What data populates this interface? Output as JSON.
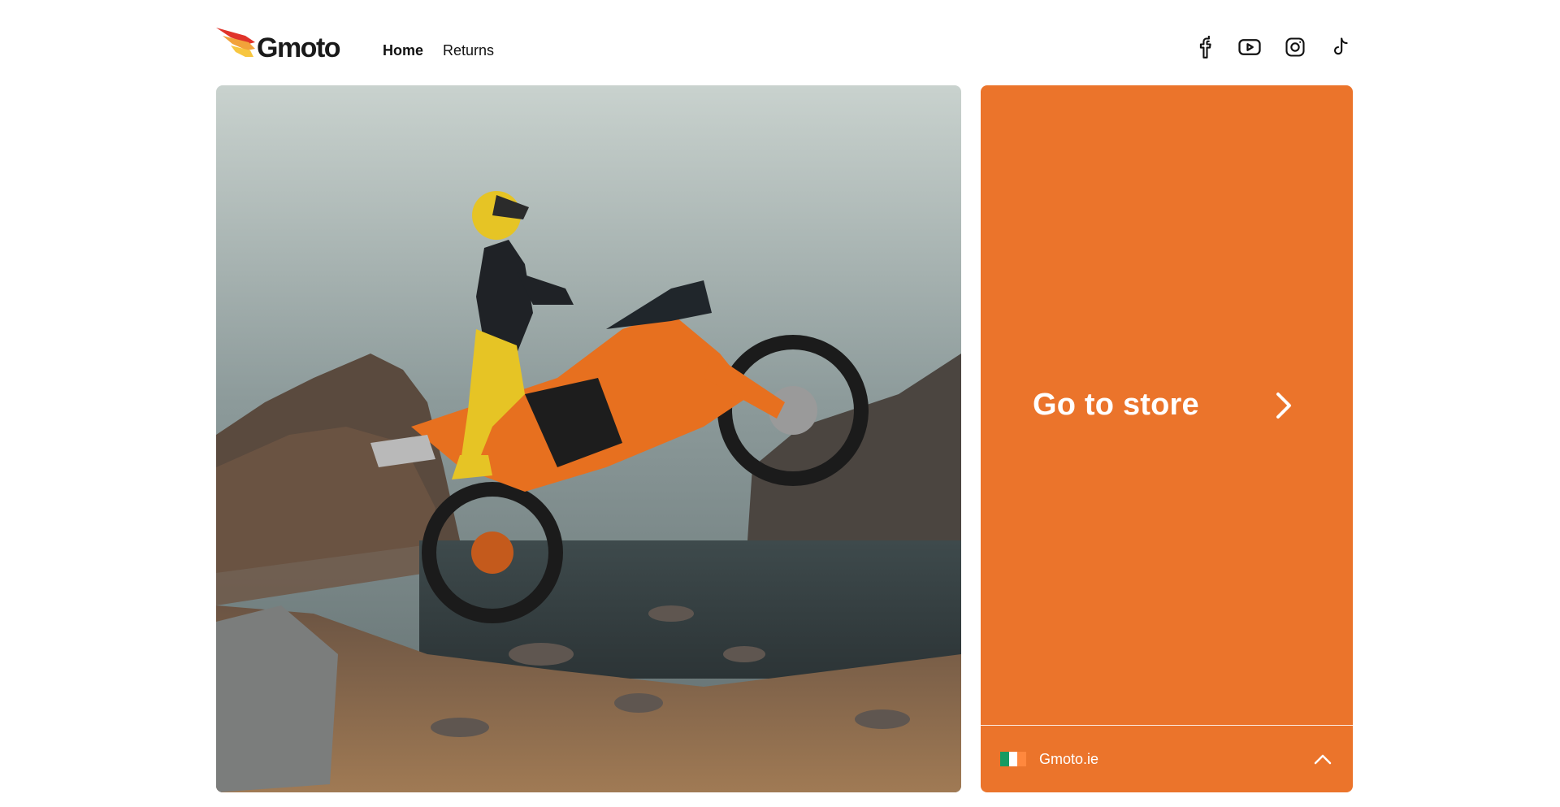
{
  "brand": {
    "name": "Gmoto",
    "colors": {
      "accent": "#eb742b",
      "logo_red": "#e0332a",
      "logo_orange": "#f2a23a",
      "logo_yellow": "#f7c640"
    }
  },
  "nav": {
    "items": [
      {
        "label": "Home",
        "active": true
      },
      {
        "label": "Returns",
        "active": false
      }
    ]
  },
  "socials": [
    {
      "icon": "facebook-icon"
    },
    {
      "icon": "youtube-icon"
    },
    {
      "icon": "instagram-icon"
    },
    {
      "icon": "tiktok-icon"
    }
  ],
  "hero": {
    "image": "motorcycle-rider-wheelie-photo"
  },
  "store": {
    "cta_label": "Go to store",
    "arrow_icon": "chevron-right-icon"
  },
  "region": {
    "label": "Gmoto.ie",
    "flag_icon": "ireland-flag-icon",
    "flag_colors": [
      "#169b62",
      "#ffffff",
      "#ff883e"
    ],
    "toggle_icon": "chevron-up-icon"
  }
}
